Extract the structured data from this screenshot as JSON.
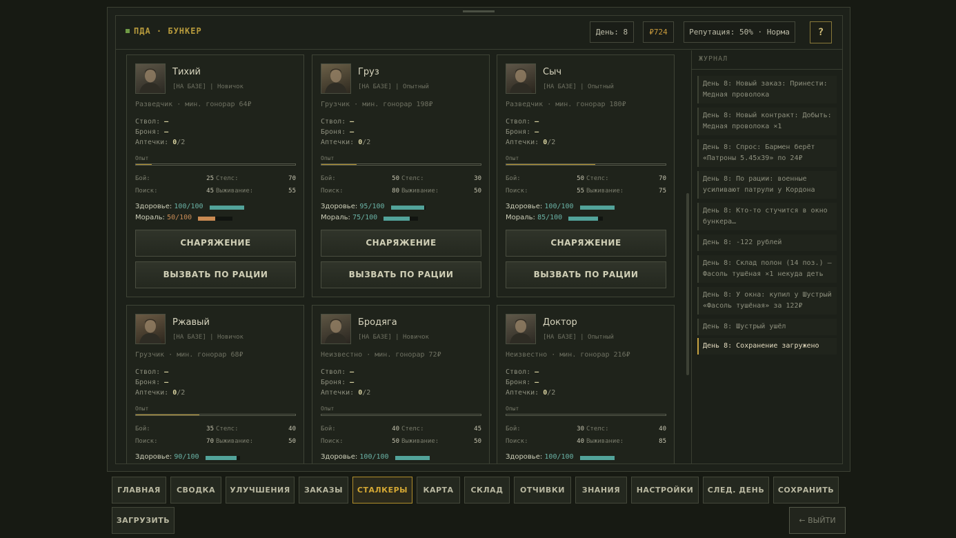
{
  "header": {
    "title": "ПДА · БУНКЕР",
    "day": "День: 8",
    "money": "₽724",
    "reputation": "Репутация: 50% · Норма",
    "help": "?"
  },
  "colors": {
    "accent": "#b08e2c",
    "health": "#52a39a",
    "warn": "#c98a52"
  },
  "labels": {
    "weapon": "Ствол:",
    "armor": "Броня:",
    "medkits": "Аптечки:",
    "xp": "Опыт",
    "combat": "Бой:",
    "stealth": "Стелс:",
    "search": "Поиск:",
    "survival": "Выживание:",
    "health": "Здоровье:",
    "morale": "Мораль:",
    "equip_button": "СНАРЯЖЕНИЕ",
    "radio_button": "ВЫЗВАТЬ ПО РАЦИИ"
  },
  "stalkers": [
    {
      "name": "Тихий",
      "status": "[НА БАЗЕ] | Новичок",
      "role": "Разведчик · мин. гонорар 64₽",
      "weapon": "—",
      "armor": "—",
      "medkits_have": "0",
      "medkits_max": "/2",
      "xp": 0.1,
      "combat": "25",
      "stealth": "70",
      "search": "45",
      "survival": "55",
      "health": "100/100",
      "health_frac": 1.0,
      "morale": "50/100",
      "morale_frac": 0.5,
      "morale_low": true
    },
    {
      "name": "Груз",
      "status": "[НА БАЗЕ] | Опытный",
      "role": "Грузчик · мин. гонорар 198₽",
      "weapon": "—",
      "armor": "—",
      "medkits_have": "0",
      "medkits_max": "/2",
      "xp": 0.22,
      "combat": "50",
      "stealth": "30",
      "search": "80",
      "survival": "50",
      "health": "95/100",
      "health_frac": 0.95,
      "morale": "75/100",
      "morale_frac": 0.75,
      "morale_low": false
    },
    {
      "name": "Сыч",
      "status": "[НА БАЗЕ] | Опытный",
      "role": "Разведчик · мин. гонорар 180₽",
      "weapon": "—",
      "armor": "—",
      "medkits_have": "0",
      "medkits_max": "/2",
      "xp": 0.56,
      "combat": "50",
      "stealth": "70",
      "search": "55",
      "survival": "75",
      "health": "100/100",
      "health_frac": 1.0,
      "morale": "85/100",
      "morale_frac": 0.85,
      "morale_low": false
    },
    {
      "name": "Ржавый",
      "status": "[НА БАЗЕ] | Новичок",
      "role": "Грузчик · мин. гонорар 68₽",
      "weapon": "—",
      "armor": "—",
      "medkits_have": "0",
      "medkits_max": "/2",
      "xp": 0.4,
      "combat": "35",
      "stealth": "40",
      "search": "70",
      "survival": "50",
      "health": "90/100",
      "health_frac": 0.9,
      "morale": "",
      "morale_frac": 0.0,
      "morale_low": false
    },
    {
      "name": "Бродяга",
      "status": "[НА БАЗЕ] | Новичок",
      "role": "Неизвестно · мин. гонорар 72₽",
      "weapon": "—",
      "armor": "—",
      "medkits_have": "0",
      "medkits_max": "/2",
      "xp": 0.0,
      "combat": "40",
      "stealth": "45",
      "search": "50",
      "survival": "50",
      "health": "100/100",
      "health_frac": 1.0,
      "morale": "",
      "morale_frac": 0.0,
      "morale_low": false
    },
    {
      "name": "Доктор",
      "status": "[НА БАЗЕ] | Опытный",
      "role": "Неизвестно · мин. гонорар 216₽",
      "weapon": "—",
      "armor": "—",
      "medkits_have": "0",
      "medkits_max": "/2",
      "xp": 0.0,
      "combat": "30",
      "stealth": "40",
      "search": "40",
      "survival": "85",
      "health": "100/100",
      "health_frac": 1.0,
      "morale": "",
      "morale_frac": 0.0,
      "morale_low": false
    }
  ],
  "journal": {
    "title": "ЖУРНАЛ",
    "entries": [
      "День 8: Новый заказ: Принести: Медная проволока",
      "День 8: Новый контракт: Добыть: Медная проволока ×1",
      "День 8: Спрос: Бармен берёт «Патроны 5.45x39» по 24₽",
      "День 8: По рации: военные усиливают патрули у Кордона",
      "День 8: Кто-то стучится в окно бункера…",
      "День 8: -122 рублей",
      "День 8: Склад полон (14 поз.) — Фасоль тушёная ×1 некуда деть",
      "День 8: У окна: купил у Шустрый «Фасоль тушёная» за 122₽",
      "День 8: Шустрый ушёл",
      "День 8: Сохранение загружено"
    ]
  },
  "tabs": [
    "ГЛАВНАЯ",
    "СВОДКА",
    "УЛУЧШЕНИЯ",
    "ЗАКАЗЫ",
    "СТАЛКЕРЫ",
    "КАРТА",
    "СКЛАД",
    "ОТЧИВКИ",
    "ЗНАНИЯ",
    "НАСТРОЙКИ",
    "СЛЕД. ДЕНЬ",
    "СОХРАНИТЬ",
    "ЗАГРУЗИТЬ"
  ],
  "active_tab": "СТАЛКЕРЫ",
  "exit_label": "← ВЫЙТИ"
}
